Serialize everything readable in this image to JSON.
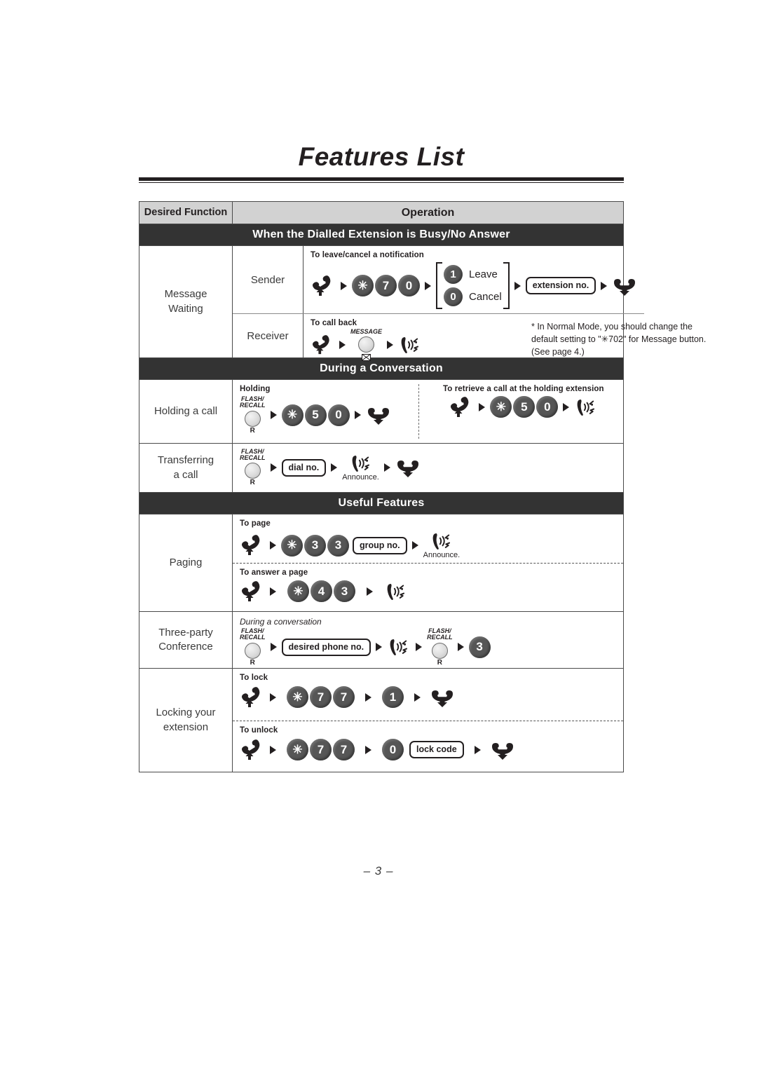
{
  "page": {
    "title": "Features List",
    "page_number": "– 3 –"
  },
  "table": {
    "headers": {
      "desired_function": "Desired Function",
      "operation": "Operation"
    },
    "sections": [
      {
        "id": "busy-no-answer",
        "banner": "When the Dialled Extension is Busy/No Answer"
      },
      {
        "id": "during-conversation",
        "banner": "During a Conversation"
      },
      {
        "id": "useful-features",
        "banner": "Useful Features"
      }
    ],
    "rows": {
      "message_waiting": {
        "function": "Message\nWaiting",
        "sender": {
          "role": "Sender",
          "caption": "To leave/cancel a notification",
          "keys": [
            "✳",
            "7",
            "0"
          ],
          "choice": [
            {
              "key": "1",
              "label": "Leave"
            },
            {
              "key": "0",
              "label": "Cancel"
            }
          ],
          "input_label": "extension no.",
          "icons": {
            "start": "off-hook-handset-icon",
            "end": "on-hook-handset-icon"
          }
        },
        "receiver": {
          "role": "Receiver",
          "caption": "To call back",
          "button_label": "MESSAGE",
          "note": "*  In Normal Mode, you should change\n    the default setting to \"✳702\" for\n    Message button. (See page 4.)"
        }
      },
      "holding_a_call": {
        "function": "Holding a call",
        "left": {
          "caption": "Holding",
          "button_label": "FLASH/\nRECALL",
          "button_sub": "R",
          "keys": [
            "✳",
            "5",
            "0"
          ]
        },
        "right": {
          "caption": "To retrieve a call at the holding extension",
          "keys": [
            "✳",
            "5",
            "0"
          ]
        }
      },
      "transferring_a_call": {
        "function": "Transferring\na call",
        "button_label": "FLASH/\nRECALL",
        "button_sub": "R",
        "input_label": "dial no.",
        "announce": "Announce."
      },
      "paging": {
        "function": "Paging",
        "to_page": {
          "caption": "To page",
          "keys": [
            "✳",
            "3",
            "3"
          ],
          "input_label": "group no.",
          "announce": "Announce."
        },
        "to_answer": {
          "caption": "To answer a page",
          "keys": [
            "✳",
            "4",
            "3"
          ]
        }
      },
      "three_party_conference": {
        "function": "Three-party\nConference",
        "caption": "During a conversation",
        "button_label": "FLASH/\nRECALL",
        "button_sub": "R",
        "input_label": "desired phone no.",
        "final_key": "3"
      },
      "locking_your_extension": {
        "function": "Locking your\nextension",
        "to_lock": {
          "caption": "To lock",
          "keys": [
            "✳",
            "7",
            "7"
          ],
          "confirm_key": "1"
        },
        "to_unlock": {
          "caption": "To unlock",
          "keys": [
            "✳",
            "7",
            "7"
          ],
          "confirm_key": "0",
          "input_label": "lock code"
        }
      }
    }
  },
  "colors": {
    "header_bg": "#d2d2d2",
    "banner_bg": "#333333",
    "key_bg": "#565656",
    "text": "#231f20",
    "border": "#4a4a4a"
  }
}
